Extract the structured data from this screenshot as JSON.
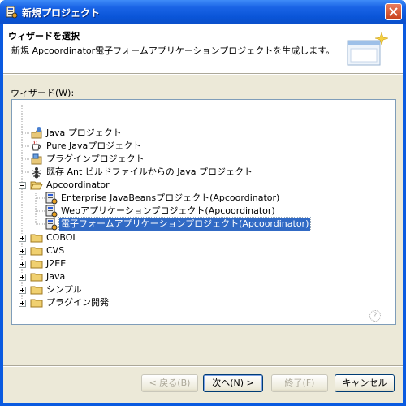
{
  "window": {
    "title": "新規プロジェクト"
  },
  "banner": {
    "title": "ウィザードを選択",
    "description": "新規 Apcoordinator電子フォームアプリケーションプロジェクトを生成します。"
  },
  "wizard_label": "ウィザード(W):",
  "tree": {
    "items": [
      {
        "label": "Java プロジェクト",
        "icon": "java-project-icon"
      },
      {
        "label": "Pure Javaプロジェクト",
        "icon": "coffee-cup-icon"
      },
      {
        "label": "プラグインプロジェクト",
        "icon": "plugin-project-icon"
      },
      {
        "label": "既存 Ant ビルドファイルからの Java プロジェクト",
        "icon": "ant-icon"
      },
      {
        "label": "Apcoordinator",
        "icon": "folder-open-icon",
        "expanded": true
      },
      {
        "label": "Enterprise JavaBeansプロジェクト(Apcoordinator)",
        "icon": "apcoordinator-project-icon"
      },
      {
        "label": "Webアプリケーションプロジェクト(Apcoordinator)",
        "icon": "apcoordinator-project-icon"
      },
      {
        "label": "電子フォームアプリケーションプロジェクト(Apcoordinator)",
        "icon": "apcoordinator-project-icon",
        "selected": true
      },
      {
        "label": "COBOL",
        "icon": "folder-icon",
        "expanded": false
      },
      {
        "label": "CVS",
        "icon": "folder-icon",
        "expanded": false
      },
      {
        "label": "J2EE",
        "icon": "folder-icon",
        "expanded": false
      },
      {
        "label": "Java",
        "icon": "folder-icon",
        "expanded": false
      },
      {
        "label": "シンプル",
        "icon": "folder-icon",
        "expanded": false
      },
      {
        "label": "プラグイン開発",
        "icon": "folder-icon",
        "expanded": false
      }
    ]
  },
  "buttons": {
    "back": "< 戻る(B)",
    "next": "次へ(N) >",
    "finish": "終了(F)",
    "cancel": "キャンセル"
  },
  "colors": {
    "titlebar": "#0a55d8",
    "selection": "#316ac5",
    "face": "#ece9d8"
  }
}
